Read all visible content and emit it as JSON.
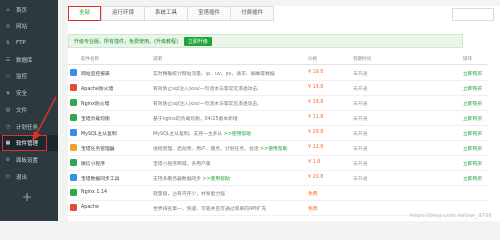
{
  "sidebar": {
    "items": [
      {
        "icon": "home-icon",
        "glyph": "⌂",
        "label": "首页"
      },
      {
        "icon": "globe-icon",
        "glyph": "◎",
        "label": "网站"
      },
      {
        "icon": "ftp-icon",
        "glyph": "⇅",
        "label": "FTP"
      },
      {
        "icon": "database-icon",
        "glyph": "☰",
        "label": "数据库"
      },
      {
        "icon": "monitor-icon",
        "glyph": "▭",
        "label": "监控"
      },
      {
        "icon": "shield-icon",
        "glyph": "◈",
        "label": "安全"
      },
      {
        "icon": "folder-icon",
        "glyph": "▤",
        "label": "文件"
      },
      {
        "icon": "clock-icon",
        "glyph": "◷",
        "label": "计划任务"
      },
      {
        "icon": "grid-icon",
        "glyph": "▦",
        "label": "软件管理"
      },
      {
        "icon": "gear-icon",
        "glyph": "⚙",
        "label": "面板设置"
      },
      {
        "icon": "logout-icon",
        "glyph": "⏻",
        "label": "退出"
      }
    ],
    "add_glyph": "+"
  },
  "tabs": [
    "全部",
    "运行环境",
    "系统工具",
    "宝塔插件",
    "付费插件"
  ],
  "promo": {
    "text": "升级专业版，所有插件，免费使用。(升级教程)",
    "button": "立即升级"
  },
  "table_header": {
    "name": "软件名称",
    "desc": "说明",
    "price": "价格",
    "expire": "到期时间",
    "op": "操作"
  },
  "rows": [
    {
      "name": "网站监控报表",
      "desc": "实时精确统计网站流量、ip、uv、pv、请求、蜘蛛等数据",
      "price": "¥ 19.8",
      "expire": "未开通",
      "op": "立即购买",
      "color": "#3b8ee6"
    },
    {
      "name": "Apache防火墙",
      "desc": "有效防止sql注入/xss/一句话木马等常见渗透攻击,",
      "price": "¥ 19.8",
      "expire": "未开通",
      "op": "立即购买",
      "color": "#e24a3b"
    },
    {
      "name": "Nginx防火墙",
      "desc": "有效防止sql注入/xss/一句话木马等常见渗透攻击,",
      "price": "¥ 19.8",
      "expire": "未开通",
      "op": "立即购买",
      "color": "#2fa84f"
    },
    {
      "name": "宝塔负载均衡",
      "desc": "基于nginx的负载均衡，04/25版本新增",
      "price": "¥ 11.8",
      "expire": "未开通",
      "op": "立即购买",
      "color": "#2fa84f"
    },
    {
      "name": "MySQL主从复制",
      "desc": "MySQL主从复制，支持一主多从",
      "tag": ">>使用帮助",
      "price": "¥ 29.8",
      "expire": "未开通",
      "op": "立即购买",
      "color": "#3b8ee6"
    },
    {
      "name": "宝塔任务管理器",
      "desc": "进程管理、启动项、用户、服务、计划任务、会话",
      "tag": ">>使用帮助",
      "price": "¥ 12.8",
      "expire": "未开通",
      "op": "立即购买",
      "color": "#f0a030"
    },
    {
      "name": "微信小程序",
      "desc": "宝塔小程序商城，多用户版",
      "price": "¥ 1.8",
      "expire": "未开通",
      "op": "立即购买",
      "color": "#2fa84f"
    },
    {
      "name": "宝塔数据同步工具",
      "desc": "支持多服务器数据同步",
      "tag": ">>使用帮助",
      "price": "¥ 29.8",
      "expire": "未开通",
      "op": "立即购买",
      "color": "#3b8ee6"
    },
    {
      "name": "Nginx 1.14",
      "desc": "轻量级，占有内存少，并发能力强",
      "price": "免费",
      "expire": "",
      "op": "",
      "color": "#2fa84f"
    },
    {
      "name": "Apache",
      "desc": "世界排名第一，快速、可靠并且可通过简单的API扩充",
      "price": "免费",
      "expire": "",
      "op": "",
      "color": "#e24a3b"
    }
  ],
  "watermark": "https://blog.csdn.net/wr_3736"
}
